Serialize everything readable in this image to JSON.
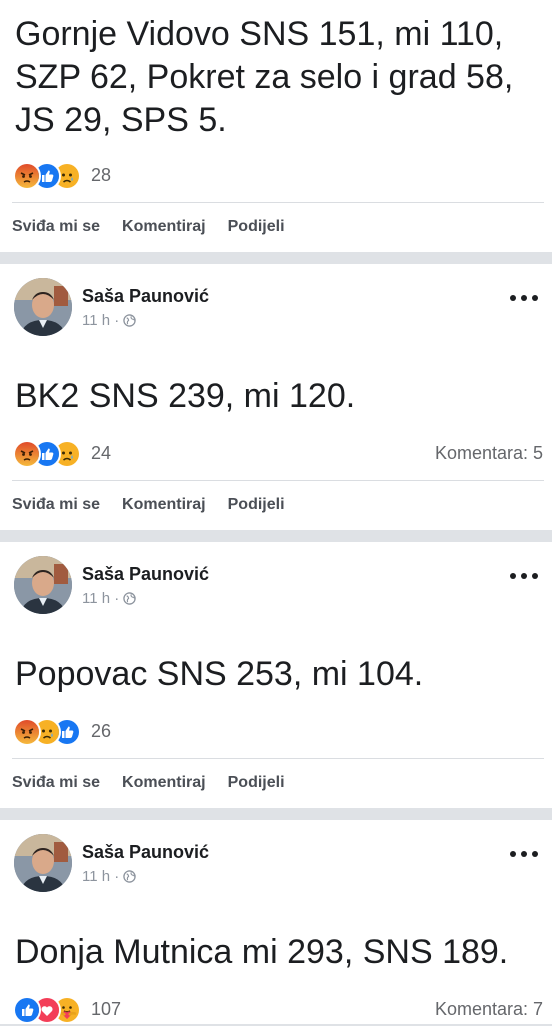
{
  "posts": [
    {
      "text": "Gornje Vidovo SNS 151, mi 110, SZP 62, Pokret za selo i grad 58, JS 29, SPS 5.",
      "reactions": [
        "angry-reaction-icon",
        "like-reaction-icon",
        "sad-reaction-icon"
      ],
      "reaction_count": "28",
      "comments": ""
    },
    {
      "author": "Saša Paunović",
      "time": "11 h ·",
      "text": "BK2 SNS 239, mi 120.",
      "reactions": [
        "angry-reaction-icon",
        "like-reaction-icon",
        "sad-reaction-icon"
      ],
      "reaction_count": "24",
      "comments": "Komentara: 5"
    },
    {
      "author": "Saša Paunović",
      "time": "11 h ·",
      "text": "Popovac SNS 253, mi 104.",
      "reactions": [
        "angry-reaction-icon",
        "sad-reaction-icon",
        "like-reaction-icon"
      ],
      "reaction_count": "26",
      "comments": ""
    },
    {
      "author": "Saša Paunović",
      "time": "11 h ·",
      "text": "Donja Mutnica mi 293, SNS 189.",
      "reactions": [
        "like-reaction-icon",
        "love-reaction-icon",
        "care-reaction-icon"
      ],
      "reaction_count": "107",
      "comments": "Komentara: 7"
    }
  ],
  "actions": {
    "like": "Sviđa mi se",
    "comment": "Komentiraj",
    "share": "Podijeli"
  },
  "colors": {
    "like": "#1877f2",
    "love": "#f33e58",
    "angry": "#e9710f",
    "sad": "#f7b125",
    "separator": "#dfe2e6"
  }
}
